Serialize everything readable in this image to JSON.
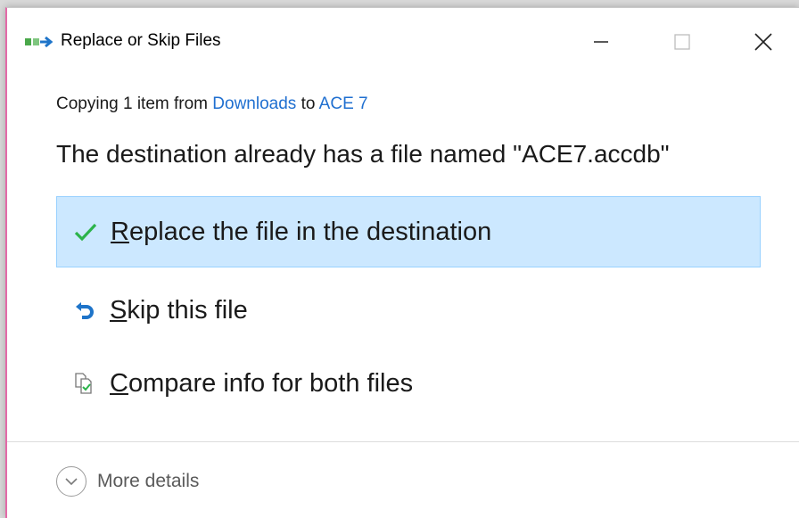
{
  "window": {
    "title": "Replace or Skip Files",
    "icon": "file-transfer-icon"
  },
  "controls": {
    "minimize": "minimize-icon",
    "maximize": "maximize-icon",
    "close": "close-icon"
  },
  "copying": {
    "prefix": "Copying 1 item from",
    "source": "Downloads",
    "mid": "to",
    "destination": "ACE 7"
  },
  "headline": "The destination already has a file named \"ACE7.accdb\"",
  "options": {
    "replace": {
      "mnemonic": "R",
      "rest": "eplace the file in the destination",
      "icon": "checkmark-icon",
      "selected": true
    },
    "skip": {
      "mnemonic": "S",
      "rest": "kip this file",
      "icon": "skip-arrow-icon"
    },
    "compare": {
      "mnemonic": "C",
      "rest": "ompare info for both files",
      "icon": "compare-files-icon"
    }
  },
  "footer": {
    "more_details": "More details"
  },
  "colors": {
    "link": "#1f6fd0",
    "selected_bg": "#cce8ff",
    "selected_border": "#99d1ff",
    "check": "#2bb34a",
    "skip_icon": "#1e74c9"
  }
}
